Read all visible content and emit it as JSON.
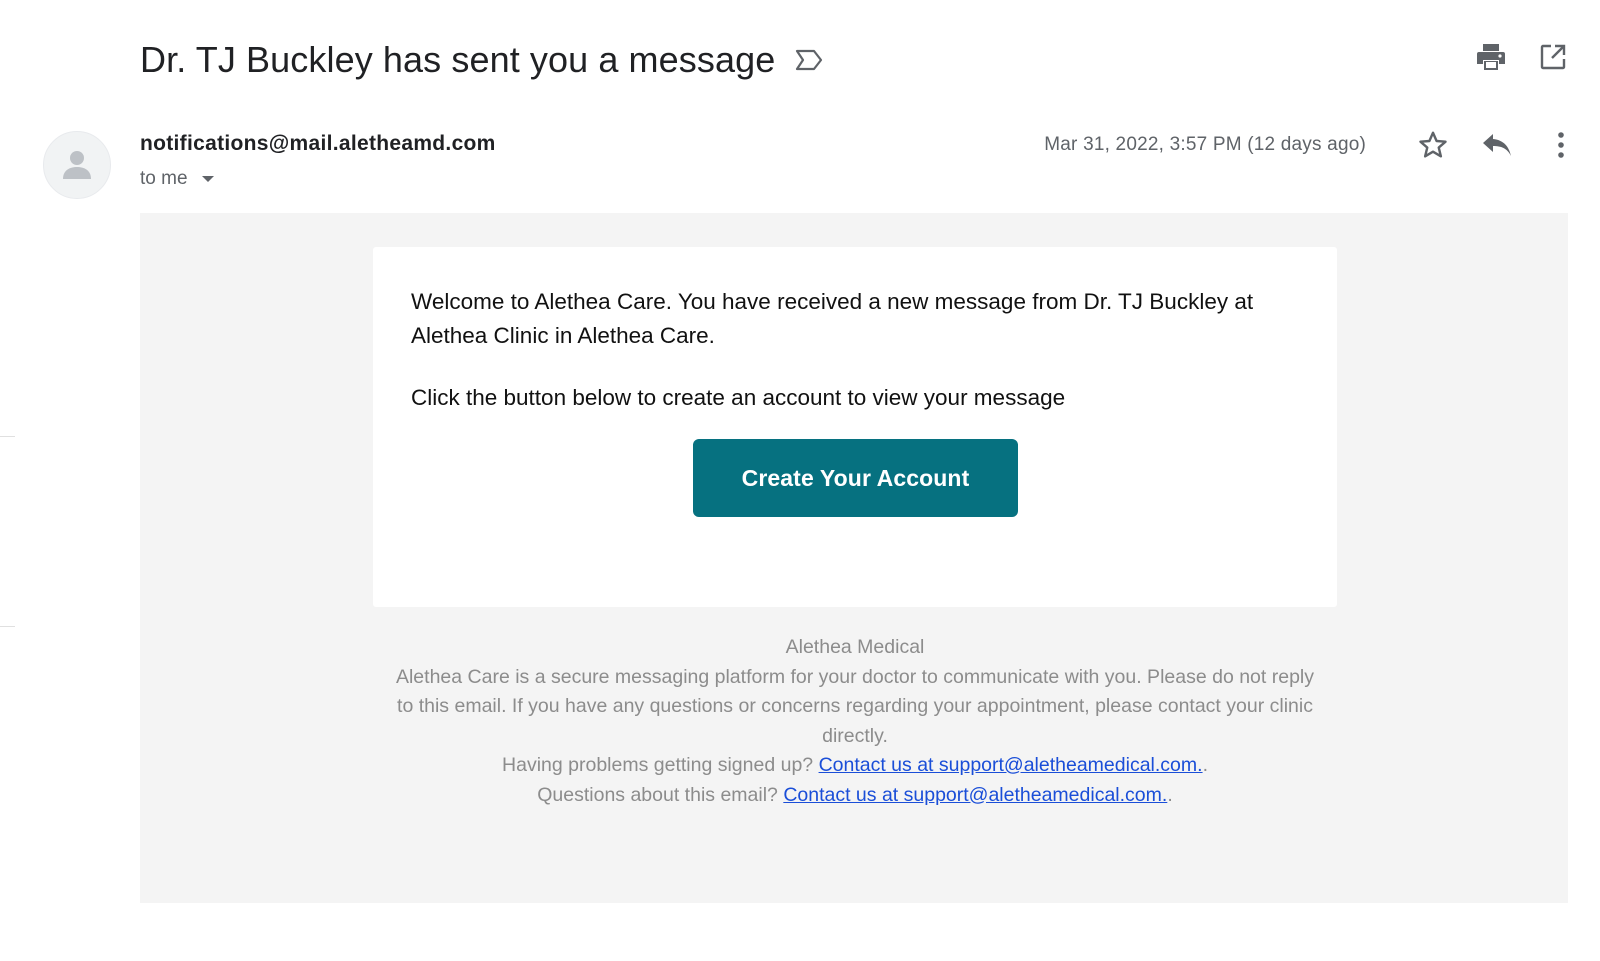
{
  "subject": "Dr. TJ Buckley has sent you a message",
  "sender": {
    "email": "notifications@mail.aletheamd.com",
    "to_label": "to me",
    "date": "Mar 31, 2022, 3:57 PM (12 days ago)"
  },
  "icons": {
    "important": "label-important-outline-icon",
    "print": "print-icon",
    "new_window": "open-in-new-icon",
    "avatar": "person-icon",
    "star": "star-outline-icon",
    "reply": "reply-icon",
    "more": "more-vertical-icon"
  },
  "email": {
    "paragraph1": "Welcome to Alethea Care. You have received a new message from Dr. TJ Buckley at Alethea Clinic in Alethea Care.",
    "paragraph2": "Click the button below to create an account to view your message",
    "cta_label": "Create Your Account",
    "footer": {
      "company": "Alethea Medical",
      "description": "Alethea Care is a secure messaging platform for your doctor to communicate with you. Please do not reply to this email. If you have any questions or concerns regarding your appointment, please contact your clinic directly.",
      "signup_prompt": "Having problems getting signed up?",
      "signup_link": "Contact us at support@aletheamedical.com.",
      "questions_prompt": "Questions about this email?",
      "questions_link": "Contact us at support@aletheamedical.com.",
      "period": "."
    }
  },
  "colors": {
    "cta_background": "#067180",
    "link": "#1a4ed8",
    "body_background": "#f4f4f4"
  }
}
